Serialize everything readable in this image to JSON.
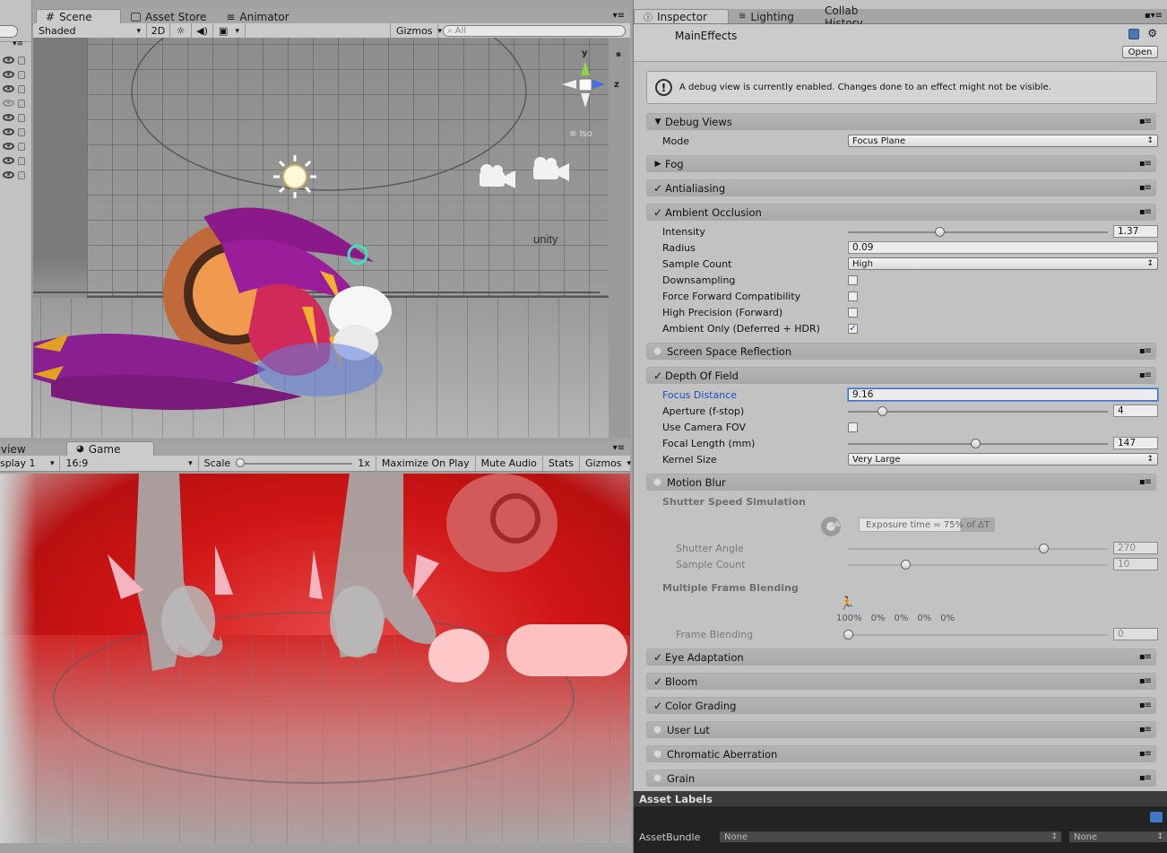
{
  "scene_tabs": [
    {
      "label": "Scene",
      "icon": "hash-icon"
    },
    {
      "label": "Asset Store",
      "icon": "store-icon"
    },
    {
      "label": "Animator",
      "icon": "animator-icon"
    }
  ],
  "scene_toolbar": {
    "shading": "Shaded",
    "mode_2d": "2D",
    "gizmos": "Gizmos",
    "search_placeholder": "All"
  },
  "scene_gizmo": {
    "y": "y",
    "z": "z",
    "iso": "Iso"
  },
  "scene_watermark": "unity",
  "game_tabs": [
    {
      "label": "view"
    },
    {
      "label": "Game"
    }
  ],
  "game_toolbar": {
    "display": "splay 1",
    "aspect": "16:9",
    "scale_label": "Scale",
    "scale_value": "1x",
    "maximize": "Maximize On Play",
    "mute": "Mute Audio",
    "stats": "Stats",
    "gizmos": "Gizmos"
  },
  "game_scale_fraction": 0.0,
  "inspector": {
    "tabs": [
      "Inspector",
      "Lighting",
      "Collab History"
    ],
    "title": "MainEffects",
    "open_button": "Open",
    "help_text": "A debug view is currently enabled. Changes done to an effect might not be visible.",
    "sections": {
      "debug_views": "Debug Views",
      "fog": "Fog",
      "antialiasing": "Antialiasing",
      "ambient_occlusion": "Ambient Occlusion",
      "ssr": "Screen Space Reflection",
      "dof": "Depth Of Field",
      "motion_blur": "Motion Blur",
      "eye_adaptation": "Eye Adaptation",
      "bloom": "Bloom",
      "color_grading": "Color Grading",
      "user_lut": "User Lut",
      "chromatic_aberration": "Chromatic Aberration",
      "grain": "Grain"
    },
    "debug": {
      "mode_label": "Mode",
      "mode_value": "Focus Plane"
    },
    "ao": {
      "intensity_label": "Intensity",
      "intensity_value": "1.37",
      "intensity_fraction": 0.35,
      "radius_label": "Radius",
      "radius_value": "0.09",
      "sample_count_label": "Sample Count",
      "sample_count_value": "High",
      "downsampling_label": "Downsampling",
      "force_forward_label": "Force Forward Compatibility",
      "high_precision_label": "High Precision (Forward)",
      "ambient_only_label": "Ambient Only (Deferred + HDR)"
    },
    "dof": {
      "focus_distance_label": "Focus Distance",
      "focus_distance_value": "9.16",
      "aperture_label": "Aperture (f-stop)",
      "aperture_value": "4",
      "aperture_fraction": 0.13,
      "use_camera_fov_label": "Use Camera FOV",
      "focal_length_label": "Focal Length (mm)",
      "focal_length_value": "147",
      "focal_length_fraction": 0.49,
      "kernel_size_label": "Kernel Size",
      "kernel_size_value": "Very Large"
    },
    "motion_blur": {
      "shutter_heading": "Shutter Speed Simulation",
      "exposure_text": "Exposure time = 75% of ΔT",
      "shutter_angle_label": "Shutter Angle",
      "shutter_angle_value": "270",
      "shutter_angle_fraction": 0.75,
      "sample_count_label": "Sample Count",
      "sample_count_value": "10",
      "sample_count_fraction": 0.22,
      "frame_heading": "Multiple Frame Blending",
      "frame_percents": [
        "100%",
        "0%",
        "0%",
        "0%",
        "0%"
      ],
      "frame_blending_label": "Frame Blending",
      "frame_blending_value": "0",
      "frame_blending_fraction": 0.0
    },
    "asset_labels": "Asset Labels",
    "asset_bundle_label": "AssetBundle",
    "asset_bundle_value": "None",
    "asset_bundle_variant": "None"
  }
}
